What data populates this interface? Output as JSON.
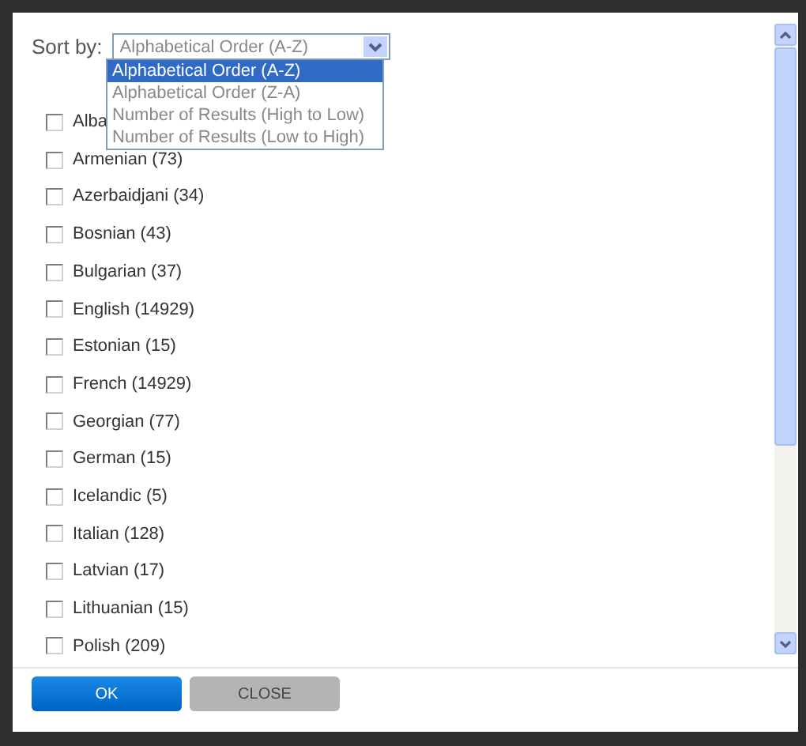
{
  "sort": {
    "label": "Sort by:",
    "value": "Alphabetical Order (A-Z)",
    "expanded": true,
    "options": [
      {
        "label": "Alphabetical Order (A-Z)",
        "selected": true
      },
      {
        "label": "Alphabetical Order (Z-A)",
        "selected": false
      },
      {
        "label": "Number of Results (High to Low)",
        "selected": false
      },
      {
        "label": "Number of Results (Low to High)",
        "selected": false
      }
    ]
  },
  "languages": [
    {
      "label": "Alba",
      "checked": false
    },
    {
      "label": "Armenian (73)",
      "checked": false
    },
    {
      "label": "Azerbaidjani (34)",
      "checked": false
    },
    {
      "label": "Bosnian (43)",
      "checked": false
    },
    {
      "label": "Bulgarian (37)",
      "checked": false
    },
    {
      "label": "English (14929)",
      "checked": false
    },
    {
      "label": "Estonian (15)",
      "checked": false
    },
    {
      "label": "French (14929)",
      "checked": false
    },
    {
      "label": "Georgian (77)",
      "checked": false
    },
    {
      "label": "German (15)",
      "checked": false
    },
    {
      "label": "Icelandic (5)",
      "checked": false
    },
    {
      "label": "Italian (128)",
      "checked": false
    },
    {
      "label": "Latvian (17)",
      "checked": false
    },
    {
      "label": "Lithuanian (15)",
      "checked": false
    },
    {
      "label": "Polish (209)",
      "checked": false
    }
  ],
  "buttons": [
    {
      "label": "OK",
      "kind": "primary"
    },
    {
      "label": "CLOSE",
      "kind": "secondary"
    }
  ]
}
